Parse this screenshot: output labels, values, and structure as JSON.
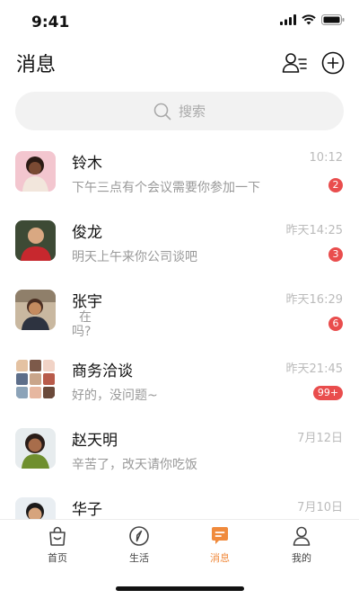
{
  "status": {
    "time": "9:41"
  },
  "header": {
    "title": "消息"
  },
  "search": {
    "placeholder": "搜索"
  },
  "chats": [
    {
      "name": "铃木",
      "message": "下午三点有个会议需要你参加一下",
      "time": "10:12",
      "unread": "2"
    },
    {
      "name": "俊龙",
      "message": "明天上午来你公司谈吧",
      "time": "昨天14:25",
      "unread": "3"
    },
    {
      "name": "张宇",
      "message": "在吗?",
      "time": "昨天16:29",
      "unread": "6"
    },
    {
      "name": "商务洽谈",
      "message": "好的，没问题~",
      "time": "昨天21:45",
      "unread": "99+"
    },
    {
      "name": "赵天明",
      "message": "辛苦了，改天请你吃饭",
      "time": "7月12日",
      "unread": ""
    },
    {
      "name": "华子",
      "message": "",
      "time": "7月10日",
      "unread": ""
    }
  ],
  "tabs": [
    {
      "label": "首页",
      "icon": "home-bag-icon",
      "active": false
    },
    {
      "label": "生活",
      "icon": "compass-icon",
      "active": false
    },
    {
      "label": "消息",
      "icon": "message-icon",
      "active": true
    },
    {
      "label": "我的",
      "icon": "user-icon",
      "active": false
    }
  ],
  "colors": {
    "accent": "#f08a3c",
    "badge": "#e94d4d",
    "search_bg": "#f2f2f2"
  }
}
